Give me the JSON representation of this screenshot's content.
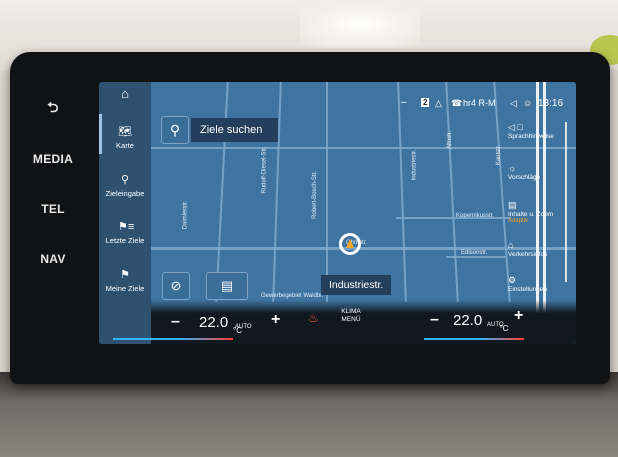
{
  "hard_buttons": {
    "back_icon": "back-arrow-icon",
    "media": "MEDIA",
    "tel": "TEL",
    "nav": "NAV"
  },
  "menu": {
    "home_icon": "home-icon",
    "items": [
      {
        "label": "Karte",
        "icon": "map-icon",
        "active": true
      },
      {
        "label": "Zieleingabe",
        "icon": "search-icon"
      },
      {
        "label": "Letzte Ziele",
        "icon": "flag-list-icon"
      },
      {
        "label": "Meine Ziele",
        "icon": "flag-icon"
      }
    ]
  },
  "search": {
    "label": "Ziele suchen"
  },
  "status": {
    "badge": "2",
    "radio": "hr4 R-M",
    "time": "13:16"
  },
  "right_panel": {
    "items": [
      {
        "label": "Sprachhinweise",
        "icon": "speaker-icon"
      },
      {
        "label": "Vorschläge",
        "icon": "lightbulb-icon"
      },
      {
        "label": "Inhalte u. Zoom",
        "sub": "Adaptiv",
        "icon": "layers-icon"
      },
      {
        "label": "Verkehrsinfos",
        "icon": "rti-icon"
      },
      {
        "label": "Einstellungen",
        "icon": "gear-icon"
      }
    ]
  },
  "map": {
    "current_street": "Industriestr.",
    "streets": [
      "Rudolf-Diesel-Str.",
      "Robert-Bosch-Str.",
      "Ohmstr.",
      "Industriestr.",
      "Kopernikusstr.",
      "Edisonstr.",
      "Altostr.",
      "Kantstr.",
      "Daimlerstr.",
      "Gewerbegebiet Waldbr."
    ]
  },
  "climate": {
    "left_minus": "–",
    "left_temp": "22.0",
    "unit": "°C",
    "left_mode": "AUTO",
    "left_plus": "+",
    "klima_line1": "KLIMA",
    "klima_line2": "MENÜ",
    "right_minus": "–",
    "right_temp": "22.0",
    "right_mode": "AUTO",
    "right_plus": "+"
  },
  "colors": {
    "accent_orange": "#f5a623",
    "map_blue": "#3f74a0",
    "heat_red": "#ff3b30",
    "cool_blue": "#34b6ff"
  }
}
